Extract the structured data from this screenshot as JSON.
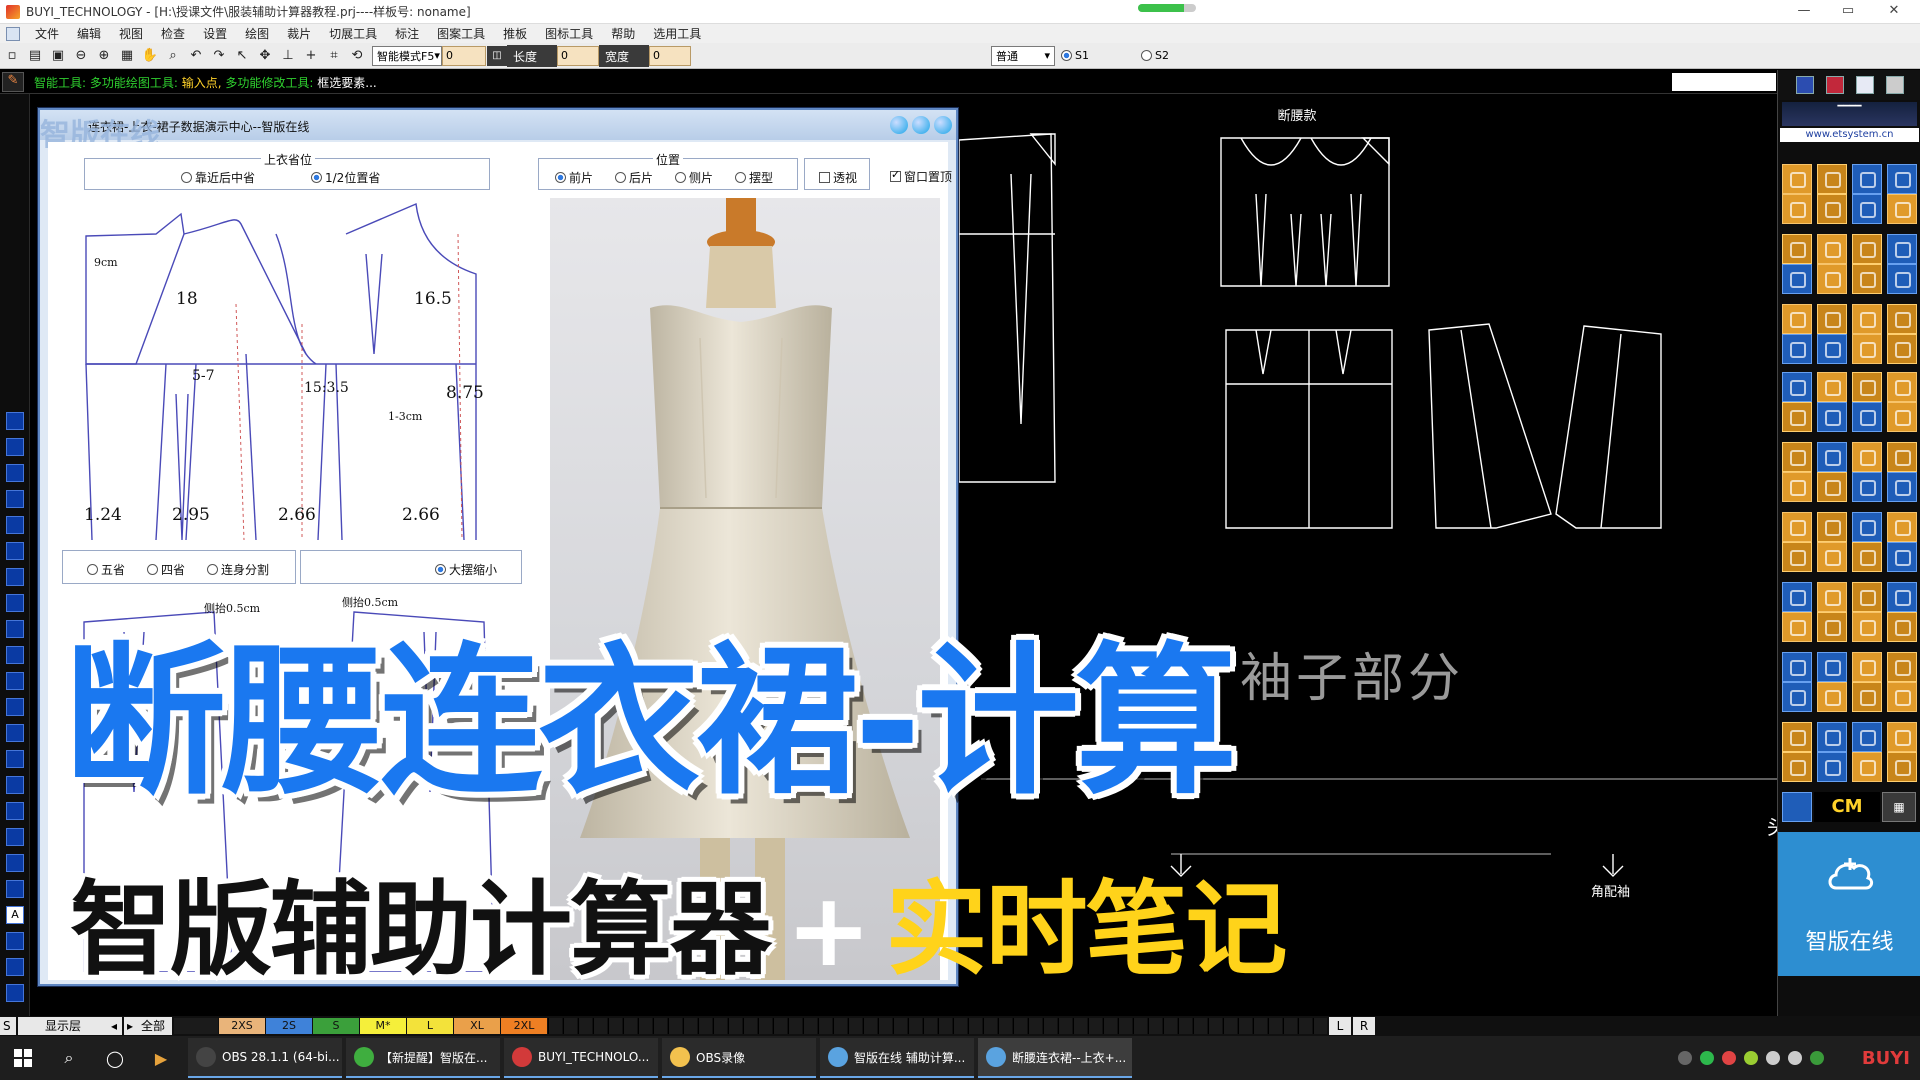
{
  "window": {
    "title": "BUYI_TECHNOLOGY - [H:\\授课文件\\服装辅助计算器教程.prj----样板号: noname]",
    "progress_percent": 80
  },
  "menu": [
    "文件",
    "编辑",
    "视图",
    "检查",
    "设置",
    "绘图",
    "裁片",
    "切展工具",
    "标注",
    "图案工具",
    "推板",
    "图标工具",
    "帮助",
    "选用工具"
  ],
  "toolbar": {
    "mode_select": "智能模式F5",
    "mode_value": "0",
    "length_label": "长度",
    "length_value": "0",
    "width_label": "宽度",
    "width_value": "0",
    "style_select": "普通",
    "radio_s1": "S1",
    "radio_s2": "S2"
  },
  "status": {
    "tool": "智能工具:",
    "draw": "多功能绘图工具:",
    "input": "输入点,",
    "modify": "多功能修改工具:",
    "action": "框选要素..."
  },
  "calc_window": {
    "title": "连衣裙-上衣-裙子数据演示中心--智版在线",
    "logo_text": "智版在线",
    "dart_group": {
      "title": "上衣省位",
      "options": [
        "靠近后中省",
        "1/2位置省"
      ],
      "selected": 1
    },
    "position_group": {
      "title": "位置",
      "options": [
        "前片",
        "后片",
        "侧片",
        "摆型"
      ],
      "selected": 0,
      "perspective": "透视",
      "pin_top": "窗口置顶"
    },
    "pattern_labels": {
      "neck": "9cm",
      "chest_left": "18",
      "chest_right": "16.5",
      "dart_range": "5-7",
      "ratio": "15:3.5",
      "side": "8.75",
      "hem_note": "1-3cm",
      "w1": "1.24",
      "w2": "2.95",
      "w3": "2.66",
      "w4": "2.66"
    },
    "dart_type_options": [
      "五省",
      "四省",
      "连身分割"
    ],
    "dart_type_selected": -1,
    "scale_option": "大摆缩小",
    "skirt_labels": {
      "lift_left": "侧抬0.5cm",
      "lift_right": "侧抬0.5cm"
    },
    "watermark": "线"
  },
  "canvas": {
    "label_top": "断腰款",
    "sleeve_note": "袖子部分",
    "right_note": "角配袖",
    "edge_char": "头"
  },
  "overlay": {
    "main_title": "断腰连衣裙-计算",
    "sub_left": "智版辅助计算器",
    "sub_plus": "+",
    "sub_right": "实时笔记"
  },
  "right_panel": {
    "url": "www.etsystem.cn",
    "unit": "CM",
    "brand": "智版在线"
  },
  "bottom_bar": {
    "s_label": "S",
    "layer_label": "显示层",
    "all_label": "全部",
    "sizes": [
      {
        "name": "2XS",
        "color": "#e9b47a"
      },
      {
        "name": "2S",
        "color": "#3f82d9"
      },
      {
        "name": "S",
        "color": "#3ba03b"
      },
      {
        "name": "M*",
        "color": "#f5ef3a"
      },
      {
        "name": "L",
        "color": "#f3e23a"
      },
      {
        "name": "XL",
        "color": "#eaa04a"
      },
      {
        "name": "2XL",
        "color": "#ee7f23"
      }
    ],
    "l_label": "L",
    "r_label": "R"
  },
  "taskbar": {
    "apps": [
      {
        "label": "OBS 28.1.1 (64-bi...",
        "color": "#444"
      },
      {
        "label": "【新提醒】智版在...",
        "color": "#3fae3f"
      },
      {
        "label": "BUYI_TECHNOLO...",
        "color": "#d23a3a"
      },
      {
        "label": "OBS录像",
        "color": "#f2c14e"
      },
      {
        "label": "智版在线 辅助计算...",
        "color": "#5aa3e0"
      },
      {
        "label": "断腰连衣裙--上衣+...",
        "color": "#5aa3e0"
      }
    ],
    "tray_text": "BUYI"
  }
}
